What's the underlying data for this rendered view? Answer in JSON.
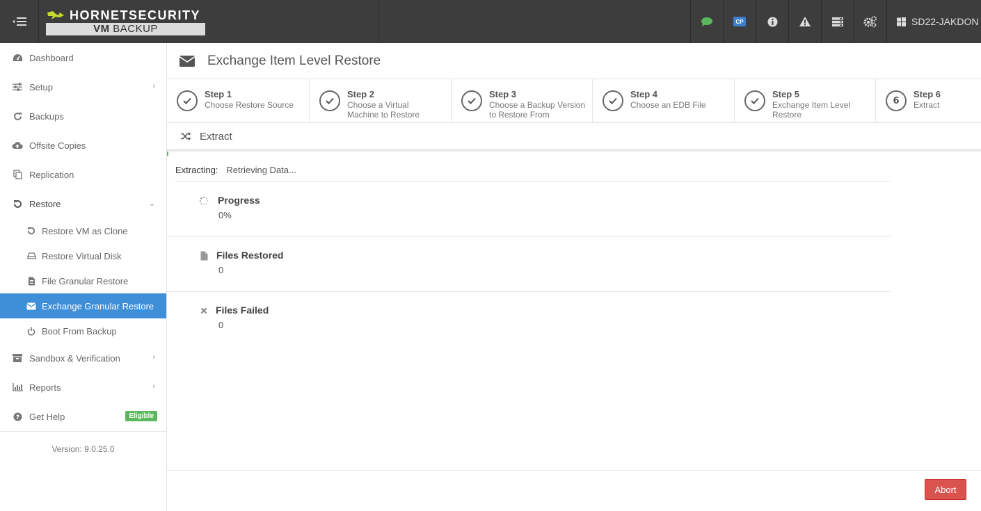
{
  "topbar": {
    "menu_icon": "menu-collapse-icon",
    "logo": {
      "brand": "HORNETSECURITY",
      "product_bold": "VM",
      "product": "BACKUP"
    },
    "icons": [
      "chat-icon",
      "cp-badge-icon",
      "info-icon",
      "warning-icon",
      "server-icon",
      "settings-icon"
    ],
    "cp_label": "CP",
    "user": "SD22-JAKDON",
    "colors": {
      "bar": "#3d3d3d",
      "chat": "#5cb85c",
      "cp": "#3a7fd0"
    }
  },
  "sidebar": {
    "items": [
      {
        "label": "Dashboard",
        "icon": "dashboard-icon"
      },
      {
        "label": "Setup",
        "icon": "sliders-icon"
      },
      {
        "label": "Backups",
        "icon": "refresh-icon"
      },
      {
        "label": "Offsite Copies",
        "icon": "cloud-upload-icon"
      },
      {
        "label": "Replication",
        "icon": "copy-icon"
      },
      {
        "label": "Restore",
        "icon": "undo-icon"
      }
    ],
    "restore_sub": [
      {
        "label": "Restore VM as Clone",
        "icon": "undo-icon"
      },
      {
        "label": "Restore Virtual Disk",
        "icon": "hdd-icon"
      },
      {
        "label": "File Granular Restore",
        "icon": "file-text-icon"
      },
      {
        "label": "Exchange Granular Restore",
        "icon": "envelope-icon",
        "active": true
      },
      {
        "label": "Boot From Backup",
        "icon": "power-icon"
      }
    ],
    "items_after": [
      {
        "label": "Sandbox & Verification",
        "icon": "archive-icon"
      },
      {
        "label": "Reports",
        "icon": "bar-chart-icon"
      },
      {
        "label": "Get Help",
        "icon": "question-circle-icon",
        "badge": "Eligible"
      }
    ],
    "version": "Version: 9.0.25.0",
    "active_color": "#3f8ed8"
  },
  "main": {
    "title": "Exchange Item Level Restore",
    "steps": [
      {
        "title": "Step 1",
        "sub": "Choose Restore Source",
        "done": true
      },
      {
        "title": "Step 2",
        "sub": "Choose a Virtual Machine to Restore",
        "done": true
      },
      {
        "title": "Step 3",
        "sub": "Choose a Backup Version to Restore From",
        "done": true
      },
      {
        "title": "Step 4",
        "sub": "Choose an EDB File",
        "done": true
      },
      {
        "title": "Step 5",
        "sub": "Exchange Item Level Restore",
        "done": true
      },
      {
        "title": "Step 6",
        "sub": "Extract",
        "done": false,
        "number": "6"
      }
    ],
    "section": "Extract",
    "status_label": "Extracting:",
    "status_value": "Retrieving Data...",
    "stats": [
      {
        "label": "Progress",
        "value": "0%",
        "icon": "spinner-icon"
      },
      {
        "label": "Files Restored",
        "value": "0",
        "icon": "file-icon"
      },
      {
        "label": "Files Failed",
        "value": "0",
        "icon": "times-icon"
      }
    ],
    "abort_label": "Abort",
    "abort_color": "#d9534f"
  }
}
